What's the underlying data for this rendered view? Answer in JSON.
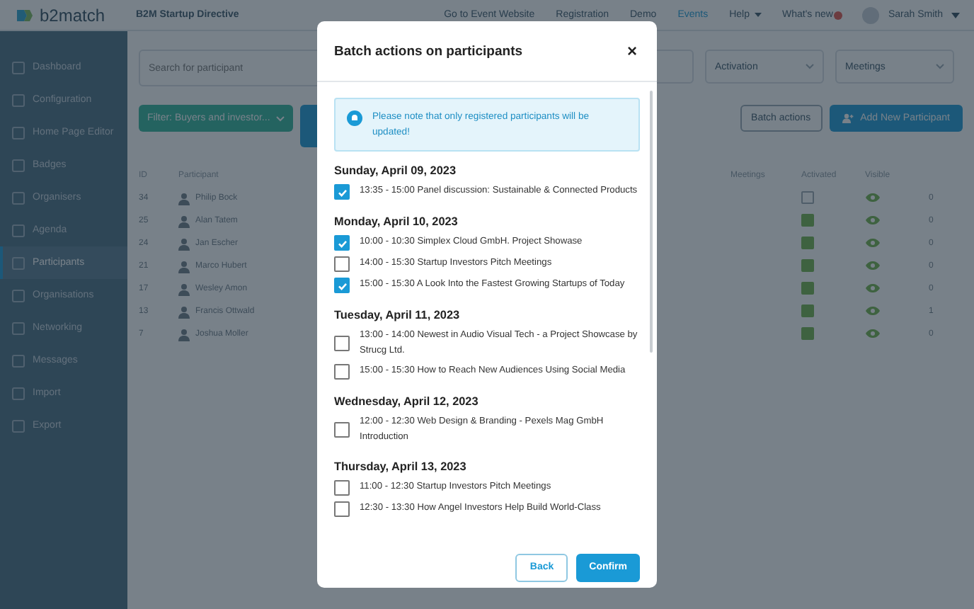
{
  "header": {
    "logo": "b2match",
    "event": "B2M Startup Directive",
    "nav": [
      {
        "label": "Go to Event Website",
        "selected": false,
        "dropdown": false
      },
      {
        "label": "Registration",
        "selected": false,
        "dropdown": false
      },
      {
        "label": "Demo",
        "selected": false,
        "dropdown": false
      },
      {
        "label": "Events",
        "selected": true,
        "dropdown": false
      },
      {
        "label": "Help",
        "selected": false,
        "dropdown": true
      },
      {
        "label": "What's new",
        "selected": false,
        "dropdown": false
      }
    ],
    "user": "Sarah Smith"
  },
  "sidebar": {
    "items": [
      {
        "label": "Dashboard",
        "selected": false
      },
      {
        "label": "Configuration",
        "selected": false
      },
      {
        "label": "Home Page Editor",
        "selected": false
      },
      {
        "label": "Badges",
        "selected": false
      },
      {
        "label": "Organisers",
        "selected": false
      },
      {
        "label": "Agenda",
        "selected": false
      },
      {
        "label": "Participants",
        "selected": true
      },
      {
        "label": "Organisations",
        "selected": false
      },
      {
        "label": "Networking",
        "selected": false
      },
      {
        "label": "Messages",
        "selected": false
      },
      {
        "label": "Import",
        "selected": false
      },
      {
        "label": "Export",
        "selected": false
      }
    ]
  },
  "filters": {
    "search": {
      "placeholder": "Search for participant"
    },
    "activation": "Activation",
    "meetings": "Meetings",
    "filter_button": "Filter: Buyers and investor...",
    "batch_button": "Batch actions",
    "add_button": "Add New Participant"
  },
  "table": {
    "columns": [
      "ID",
      "Participant",
      "Meetings",
      "Activated",
      "Visible"
    ],
    "rows": [
      {
        "id": "34",
        "name": "Philip Bock",
        "activated": false,
        "column_6": "0"
      },
      {
        "id": "25",
        "name": "Alan Tatem",
        "activated": true,
        "column_6": "0"
      },
      {
        "id": "24",
        "name": "Jan Escher",
        "activated": true,
        "column_6": "0"
      },
      {
        "id": "21",
        "name": "Marco Hubert",
        "activated": true,
        "column_6": "0"
      },
      {
        "id": "17",
        "name": "Wesley Amon",
        "activated": true,
        "column_6": "0"
      },
      {
        "id": "13",
        "name": "Francis Ottwald",
        "activated": true,
        "column_6": "1"
      },
      {
        "id": "7",
        "name": "Joshua Moller",
        "activated": true,
        "column_6": "0"
      }
    ]
  },
  "modal": {
    "title": "Batch actions on participants",
    "close": "×",
    "notice": "Please note that only registered participants will be updated!",
    "days": [
      {
        "date": "Sunday, April 09, 2023",
        "sessions": [
          {
            "text": "13:35 - 15:00 Panel discussion: Sustainable & Connected Products",
            "checked": true
          }
        ]
      },
      {
        "date": "Monday, April 10, 2023",
        "sessions": [
          {
            "text": "10:00 - 10:30 Simplex Cloud GmbH. Project Showase",
            "checked": true
          },
          {
            "text": "14:00 - 15:30 Startup Investors Pitch Meetings",
            "checked": false
          },
          {
            "text": "15:00 - 15:30 A Look Into the Fastest Growing Startups of Today",
            "checked": true
          }
        ]
      },
      {
        "date": "Tuesday, April 11, 2023",
        "sessions": [
          {
            "text": "13:00 - 14:00 Newest in Audio Visual Tech - a Project Showcase by Strucg Ltd.",
            "checked": false
          },
          {
            "text": "15:00 - 15:30 How to Reach New Audiences Using Social Media",
            "checked": false
          }
        ]
      },
      {
        "date": "Wednesday, April 12, 2023",
        "sessions": [
          {
            "text": "12:00 - 12:30 Web Design & Branding - Pexels Mag GmbH Introduction",
            "checked": false
          }
        ]
      },
      {
        "date": "Thursday, April 13, 2023",
        "sessions": [
          {
            "text": "11:00 - 12:30 Startup Investors Pitch Meetings",
            "checked": false
          },
          {
            "text": "12:30 - 13:30 How Angel Investors Help Build World-Class",
            "checked": false
          }
        ]
      }
    ],
    "back": "Back",
    "confirm": "Confirm"
  }
}
